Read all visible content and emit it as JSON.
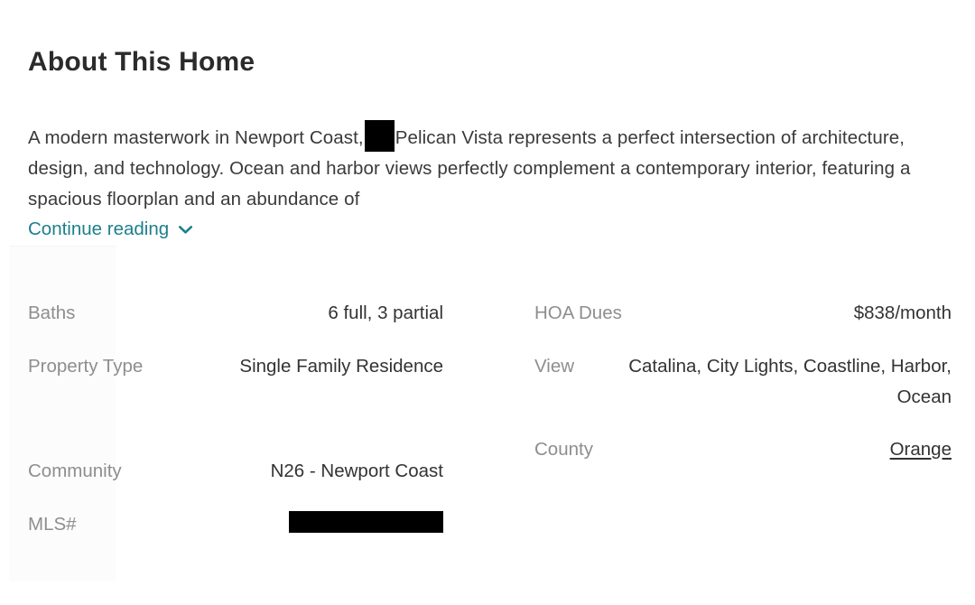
{
  "section": {
    "title": "About This Home"
  },
  "description": {
    "text_before_redaction": "A modern masterwork in Newport Coast,",
    "redaction_label": "redacted-text",
    "text_after_redaction": "Pelican Vista represents a perfect intersection of architecture, design, and technology. Ocean and harbor views perfectly complement a contemporary interior, featuring a spacious floorplan and an abundance of"
  },
  "continue_reading": {
    "label": "Continue reading",
    "icon": "chevron-down-icon",
    "color": "#1d7f8c"
  },
  "facts": {
    "left_column": [
      {
        "label": "Baths",
        "value": "6 full, 3 partial",
        "type": "text"
      },
      {
        "label": "Property Type",
        "value": "Single Family Residence",
        "type": "text"
      },
      {
        "label": "Community",
        "value": "N26 - Newport Coast",
        "type": "text"
      },
      {
        "label": "MLS#",
        "value": "",
        "type": "redacted"
      }
    ],
    "right_column": [
      {
        "label": "HOA Dues",
        "value": "$838/month",
        "type": "text"
      },
      {
        "label": "View",
        "value": "Catalina, City Lights, Coastline, Harbor, Ocean",
        "type": "text"
      },
      {
        "label": "County",
        "value": "Orange",
        "type": "link"
      }
    ]
  },
  "colors": {
    "accent": "#1d7f8c",
    "label_gray": "#8e8e8e",
    "value_dark": "#333333",
    "heading": "#2b2b2b",
    "redaction": "#000000",
    "band_tint": "#fcfcfd"
  }
}
